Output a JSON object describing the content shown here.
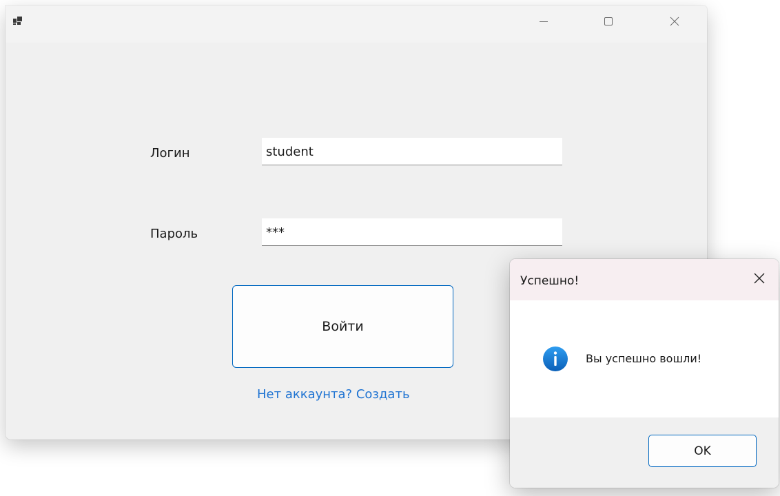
{
  "main_window": {
    "icons": {
      "app": "app-icon",
      "minimize": "minimize-icon",
      "maximize": "maximize-icon",
      "close": "close-icon"
    },
    "form": {
      "login_label": "Логин",
      "login_value": "student",
      "password_label": "Пароль",
      "password_value": "***",
      "submit_label": "Войти",
      "register_link": "Нет аккаунта? Создать"
    }
  },
  "message_box": {
    "title": "Успешно!",
    "message": "Вы успешно вошли!",
    "icon": "info-icon",
    "ok_label": "OK"
  },
  "colors": {
    "accent": "#0067c0",
    "link": "#1e73d2",
    "window_bg": "#f0f0f0",
    "dialog_titlebar": "#f7eef1"
  }
}
